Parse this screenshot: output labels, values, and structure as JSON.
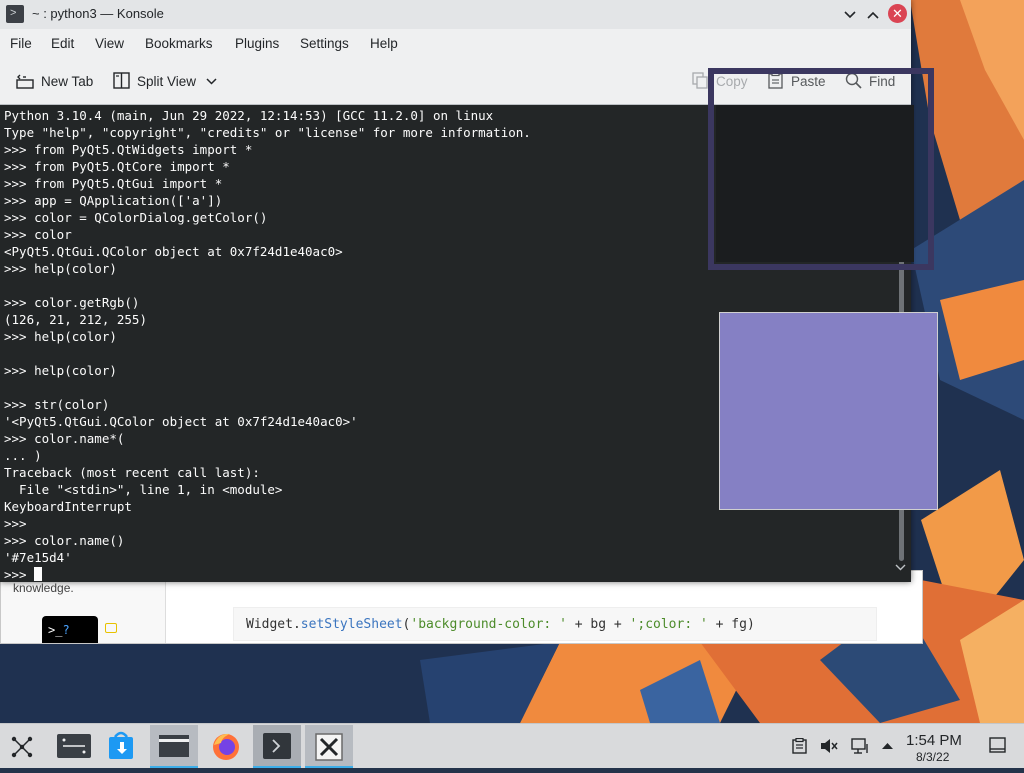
{
  "colors": {
    "accent": "#3daee9",
    "terminal_bg": "#232627",
    "picked_color": "#7e15d4",
    "swatch_color": "#8580c4",
    "close_button": "#da4453"
  },
  "window": {
    "title": "~ : python3 — Konsole",
    "icon": "konsole-icon"
  },
  "menu": {
    "items": [
      "File",
      "Edit",
      "View",
      "Bookmarks",
      "Plugins",
      "Settings",
      "Help"
    ]
  },
  "toolbar": {
    "new_tab": "New Tab",
    "split_view": "Split View",
    "copy": "Copy",
    "paste": "Paste",
    "find": "Find"
  },
  "terminal": {
    "lines": [
      "Python 3.10.4 (main, Jun 29 2022, 12:14:53) [GCC 11.2.0] on linux",
      "Type \"help\", \"copyright\", \"credits\" or \"license\" for more information.",
      ">>> from PyQt5.QtWidgets import *",
      ">>> from PyQt5.QtCore import *",
      ">>> from PyQt5.QtGui import *",
      ">>> app = QApplication(['a'])",
      ">>> color = QColorDialog.getColor()",
      ">>> color",
      "<PyQt5.QtGui.QColor object at 0x7f24d1e40ac0>",
      ">>> help(color)",
      "",
      ">>> color.getRgb()",
      "(126, 21, 212, 255)",
      ">>> help(color)",
      "",
      ">>> help(color)",
      "",
      ">>> str(color)",
      "'<PyQt5.QtGui.QColor object at 0x7f24d1e40ac0>'",
      ">>> color.name*(",
      "... )",
      "Traceback (most recent call last):",
      "  File \"<stdin>\", line 1, in <module>",
      "KeyboardInterrupt",
      ">>>",
      ">>> color.name()",
      "'#7e15d4'"
    ],
    "prompt": ">>> "
  },
  "background_page": {
    "text": "knowledge.",
    "code_prefix": "Widget.",
    "code_fn": "setStyleSheet",
    "code_open": "(",
    "code_str1": "'background-color: '",
    "code_mid1": " + bg + ",
    "code_str2": "';color: '",
    "code_end": " + fg)"
  },
  "taskbar": {
    "apps": [
      {
        "name": "application-launcher"
      },
      {
        "name": "pager"
      },
      {
        "name": "discover"
      },
      {
        "name": "dolphin"
      },
      {
        "name": "firefox"
      },
      {
        "name": "konsole"
      },
      {
        "name": "xterm"
      }
    ],
    "time": "1:54 PM",
    "date": "8/3/22"
  }
}
